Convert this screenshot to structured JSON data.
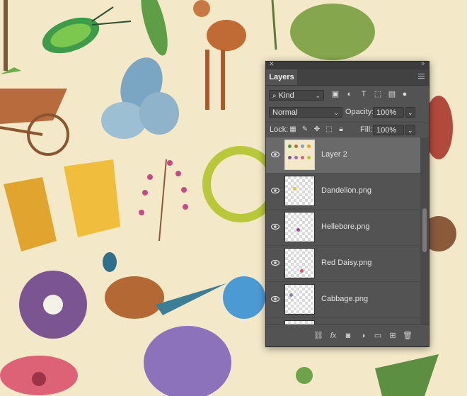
{
  "panel": {
    "title": "Layers",
    "filter": {
      "kind_label": "Kind",
      "icons": [
        "image-filter-icon",
        "adjustment-filter-icon",
        "type-filter-icon",
        "shape-filter-icon",
        "smart-object-filter-icon",
        "filter-toggle-icon"
      ]
    },
    "blend": {
      "mode": "Normal",
      "opacity_label": "Opacity:",
      "opacity_value": "100%"
    },
    "lock": {
      "label": "Lock:",
      "fill_label": "Fill:",
      "fill_value": "100%"
    },
    "layers": [
      {
        "name": "Layer 2",
        "selected": true,
        "thumb": "artwork"
      },
      {
        "name": "Dandelion.png",
        "selected": false,
        "thumb": "transparent",
        "dot": "#e9c233"
      },
      {
        "name": "Hellebore.png",
        "selected": false,
        "thumb": "transparent",
        "dot": "#8e4f93"
      },
      {
        "name": "Red Daisy.png",
        "selected": false,
        "thumb": "transparent",
        "dot": "#d9566b"
      },
      {
        "name": "Cabbage.png",
        "selected": false,
        "thumb": "transparent",
        "dot": "#8d78b8"
      },
      {
        "name": "",
        "selected": false,
        "thumb": "transparent"
      }
    ],
    "bottom_icons": [
      "link-layers-icon",
      "fx-icon",
      "add-mask-icon",
      "adjustment-layer-icon",
      "new-group-icon",
      "new-layer-icon",
      "delete-layer-icon"
    ]
  },
  "colors": {
    "panel_bg": "#535353",
    "selected_layer": "#6a6a6a",
    "canvas_bg": "#f3e9c9"
  }
}
